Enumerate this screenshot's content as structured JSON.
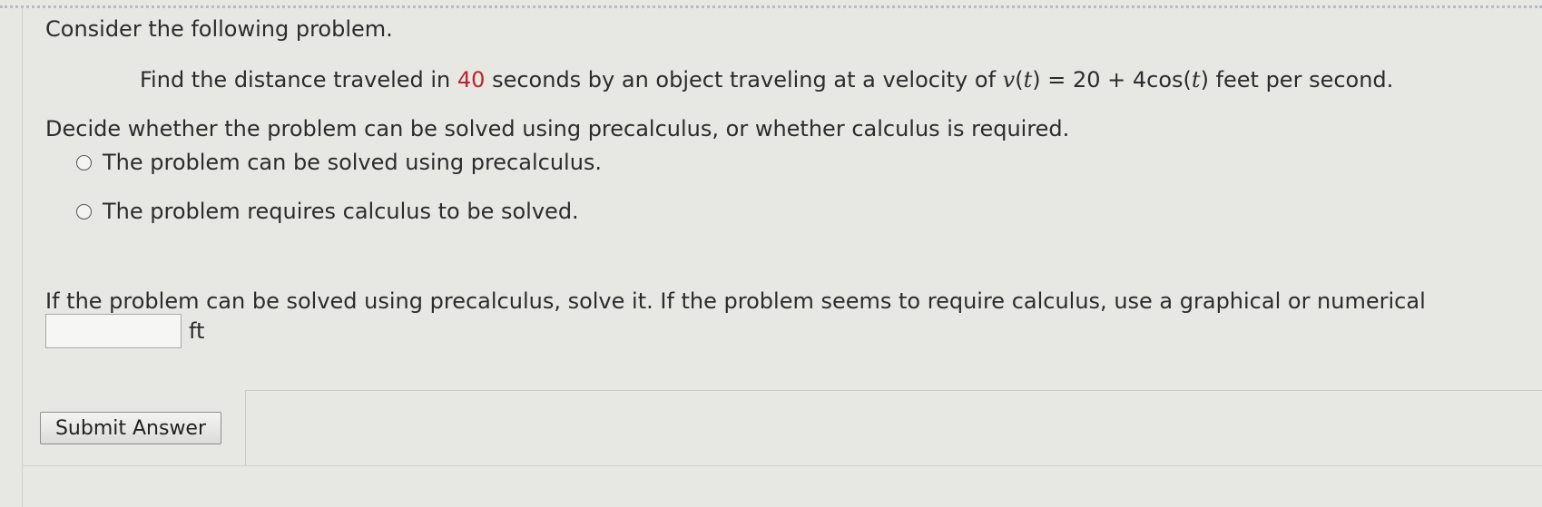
{
  "question": {
    "heading": "Consider the following problem.",
    "statement": {
      "part1": "Find the distance traveled in ",
      "seconds_value": "40",
      "part2": " seconds by an object traveling at a velocity of ",
      "v": "v",
      "paren_open": "(",
      "t": "t",
      "paren_close": ")",
      "part3": " = 20 + 4cos(",
      "part4": ") feet per second."
    },
    "decide_prompt": "Decide whether the problem can be solved using precalculus, or whether calculus is required.",
    "options": [
      {
        "label": "The problem can be solved using precalculus."
      },
      {
        "label": "The problem requires calculus to be solved."
      }
    ],
    "instruction": "If the problem can be solved using precalculus, solve it. If the problem seems to require calculus, use a graphical or numerical",
    "answer": {
      "value": "",
      "unit": "ft"
    },
    "submit_label": "Submit Answer"
  },
  "colors": {
    "highlight": "#c2232a",
    "background": "#e7e7e4"
  }
}
